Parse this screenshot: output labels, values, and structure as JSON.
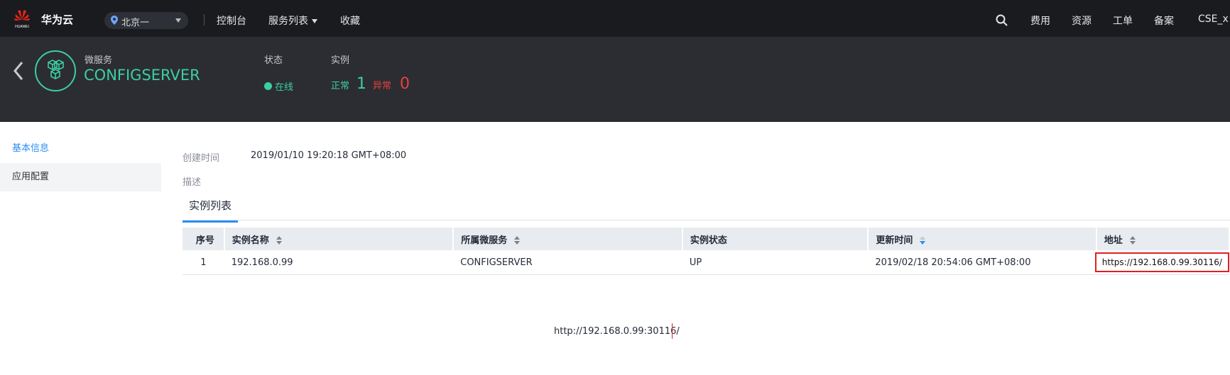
{
  "topbar": {
    "logo_text": "HUAWEI",
    "brand": "华为云",
    "region": "北京一",
    "nav": [
      "控制台",
      "服务列表",
      "收藏"
    ],
    "right_nav": [
      "费用",
      "资源",
      "工单",
      "备案",
      "CSE_x"
    ]
  },
  "header": {
    "service_type": "微服务",
    "service_name": "CONFIGSERVER",
    "status_label": "状态",
    "status_value": "在线",
    "instances_label": "实例",
    "normal_label": "正常",
    "normal_count": "1",
    "abnormal_label": "异常",
    "abnormal_count": "0"
  },
  "sidebar": {
    "items": [
      {
        "label": "基本信息",
        "active": true
      },
      {
        "label": "应用配置",
        "active": false
      }
    ]
  },
  "details": {
    "created_label": "创建时间",
    "created_value": "2019/01/10 19:20:18 GMT+08:00",
    "desc_label": "描述"
  },
  "tabs": [
    "实例列表"
  ],
  "table": {
    "headers": [
      "序号",
      "实例名称",
      "所属微服务",
      "实例状态",
      "更新时间",
      "地址"
    ],
    "rows": [
      [
        "1",
        "192.168.0.99",
        "CONFIGSERVER",
        "UP",
        "2019/02/18 20:54:06 GMT+08:00",
        "https://192.168.0.99.30116/"
      ]
    ]
  },
  "annotation_url": "http://192.168.0.99:30116/",
  "colors": {
    "accent_green": "#3ccfa0",
    "error_red": "#e8403d",
    "link_blue": "#2c8df4",
    "topbar_bg": "#1a1b1e",
    "header_bg": "#2b2d33"
  }
}
